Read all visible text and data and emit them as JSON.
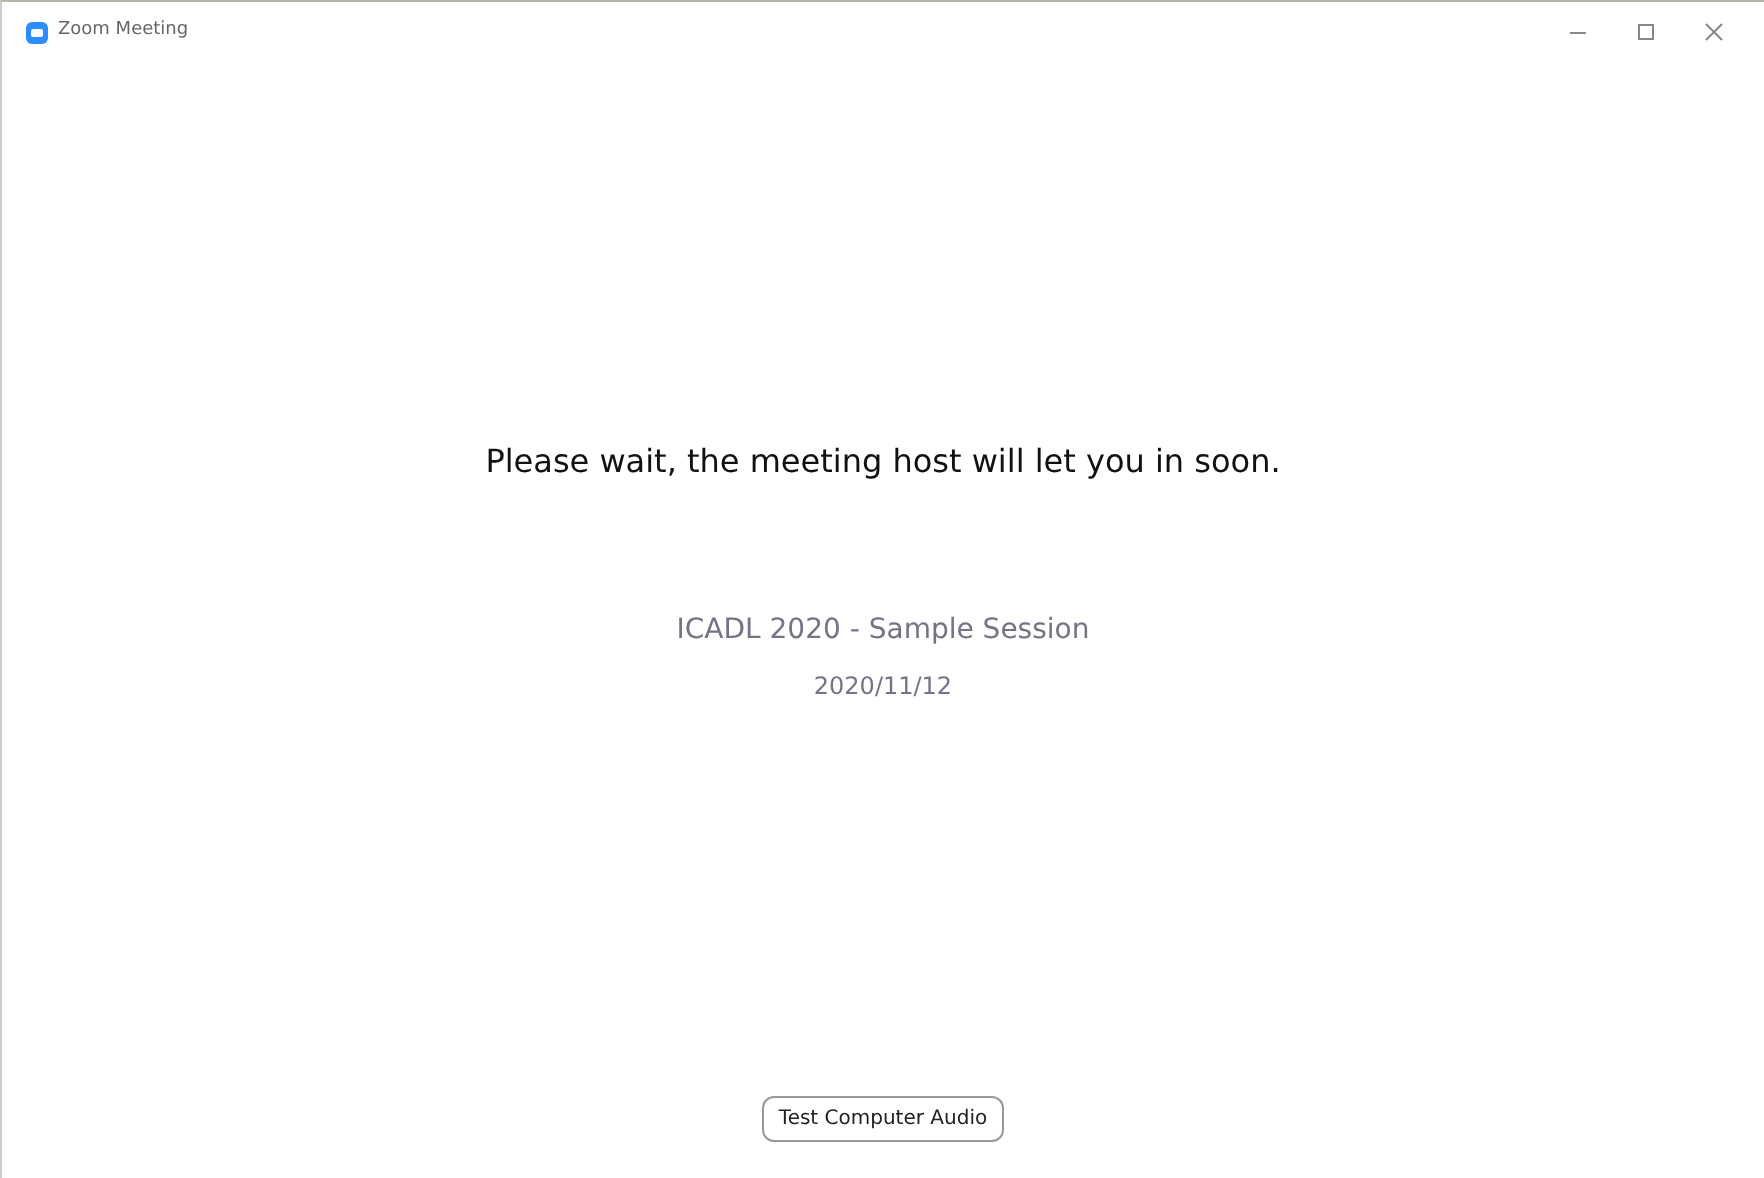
{
  "window": {
    "title": "Zoom Meeting"
  },
  "message": "Please wait, the meeting host will let you in soon.",
  "meeting": {
    "topic": "ICADL 2020 - Sample Session",
    "date": "2020/11/12"
  },
  "buttons": [
    "Test Computer Audio"
  ]
}
